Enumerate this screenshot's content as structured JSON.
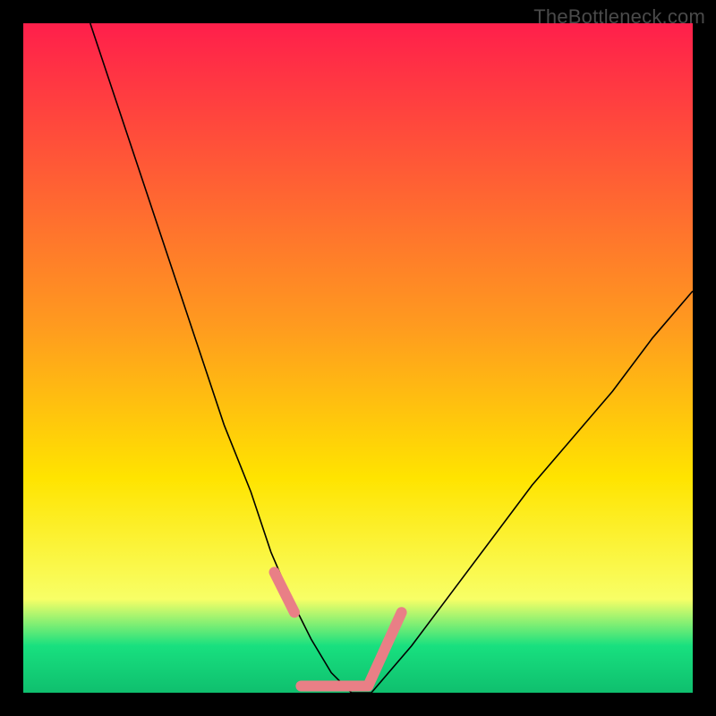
{
  "watermark": {
    "text": "TheBottleneck.com"
  },
  "colors": {
    "bg": "#000000",
    "grad_top": "#ff1f4b",
    "grad_mid": "#ffe400",
    "grad_bottom_y": "#f8ff66",
    "grad_green": "#18e07f",
    "grad_bottom": "#0fbf6e",
    "curve": "#000000",
    "accent": "#e97f86"
  },
  "chart_data": {
    "type": "line",
    "title": "",
    "xlabel": "",
    "ylabel": "",
    "xlim": [
      0,
      100
    ],
    "ylim": [
      0,
      100
    ],
    "series": [
      {
        "name": "bottleneck-curve",
        "x": [
          10,
          14,
          18,
          22,
          26,
          30,
          34,
          37,
          40,
          43,
          46,
          49,
          52,
          58,
          64,
          70,
          76,
          82,
          88,
          94,
          100
        ],
        "values": [
          100,
          88,
          76,
          64,
          52,
          40,
          30,
          21,
          14,
          8,
          3,
          0,
          0,
          7,
          15,
          23,
          31,
          38,
          45,
          53,
          60
        ]
      }
    ],
    "accent_segments": [
      {
        "name": "left-dash",
        "x": [
          37.5,
          40.5
        ],
        "y": [
          18,
          12
        ]
      },
      {
        "name": "bottom-dash",
        "x": [
          41.5,
          51.5
        ],
        "y": [
          1,
          1
        ]
      },
      {
        "name": "right-dash",
        "x": [
          51.5,
          56.5
        ],
        "y": [
          1,
          12
        ]
      }
    ],
    "gradient_stops": [
      {
        "offset": 0.0,
        "color": "#ff1f4b"
      },
      {
        "offset": 0.45,
        "color": "#ff9a1f"
      },
      {
        "offset": 0.68,
        "color": "#ffe400"
      },
      {
        "offset": 0.86,
        "color": "#f8ff66"
      },
      {
        "offset": 0.93,
        "color": "#18e07f"
      },
      {
        "offset": 1.0,
        "color": "#0fbf6e"
      }
    ]
  }
}
